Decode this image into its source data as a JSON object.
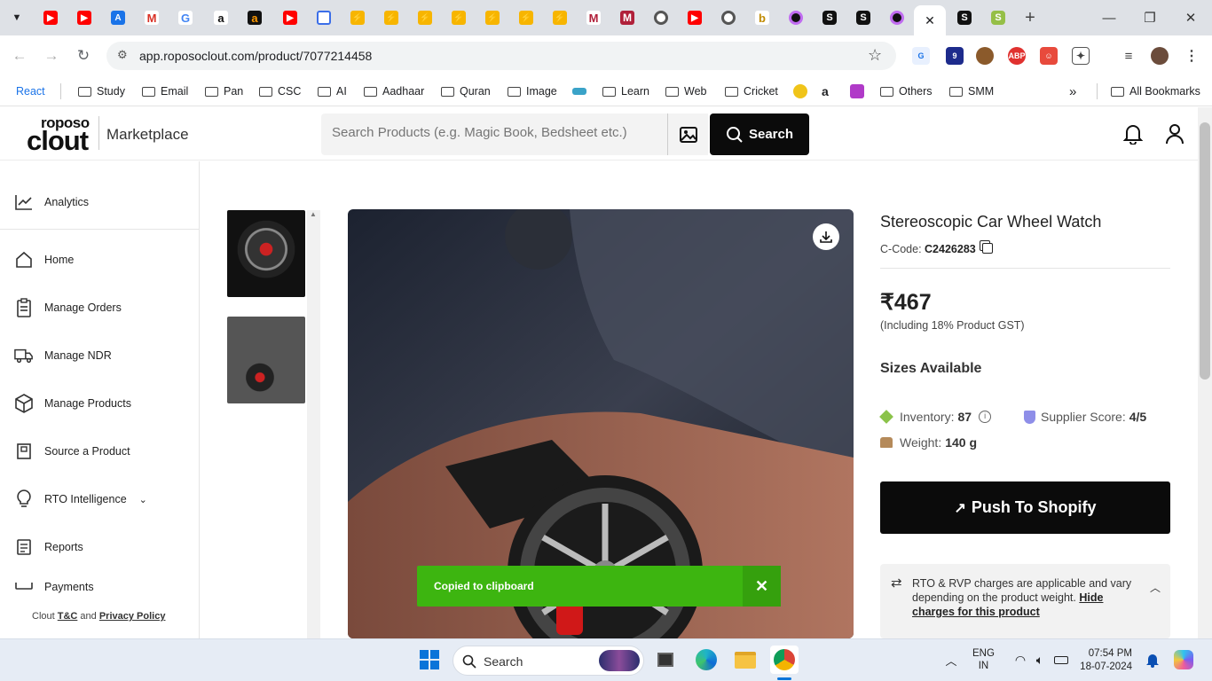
{
  "browser": {
    "url": "app.roposoclout.com/product/7077214458",
    "new_tab": "+",
    "close_tab": "✕"
  },
  "bookmarks": {
    "items": [
      "React",
      "Study",
      "Email",
      "Pan",
      "CSC",
      "AI",
      "Aadhaar",
      "Quran",
      "Image",
      "Learn",
      "Web",
      "Cricket",
      "Others",
      "SMM"
    ],
    "all_bookmarks": "All Bookmarks"
  },
  "header": {
    "logo_top": "roposo",
    "logo_bottom": "clout",
    "section": "Marketplace",
    "search_placeholder": "Search Products (e.g. Magic Book, Bedsheet etc.)",
    "search_button": "Search"
  },
  "sidebar": {
    "items": [
      "Analytics",
      "Home",
      "Manage Orders",
      "Manage NDR",
      "Manage Products",
      "Source a Product",
      "RTO Intelligence",
      "Reports",
      "Payments"
    ],
    "footer_prefix": "Clout",
    "footer_tc": "T&C",
    "footer_and": "and",
    "footer_privacy": "Privacy Policy"
  },
  "product": {
    "title": "Stereoscopic Car Wheel Watch",
    "ccode_label": "C-Code:",
    "ccode_value": "C2426283",
    "price": "₹467",
    "gst_note": "(Including 18% Product GST)",
    "sizes_heading": "Sizes Available",
    "inventory_label": "Inventory:",
    "inventory_value": "87",
    "supplier_label": "Supplier Score:",
    "supplier_value": "4/5",
    "weight_label": "Weight:",
    "weight_value": "140 g",
    "push_button": "Push To Shopify",
    "rto_text": "RTO & RVP charges are applicable and vary depending on the product weight.",
    "rto_link": "Hide charges for this product"
  },
  "toast": {
    "message": "Copied to clipboard"
  },
  "taskbar": {
    "search": "Search",
    "lang_top": "ENG",
    "lang_bottom": "IN",
    "time": "07:54 PM",
    "date": "18-07-2024"
  },
  "colors": {
    "toast_green": "#3db510",
    "brand_black": "#0b0b0b"
  }
}
